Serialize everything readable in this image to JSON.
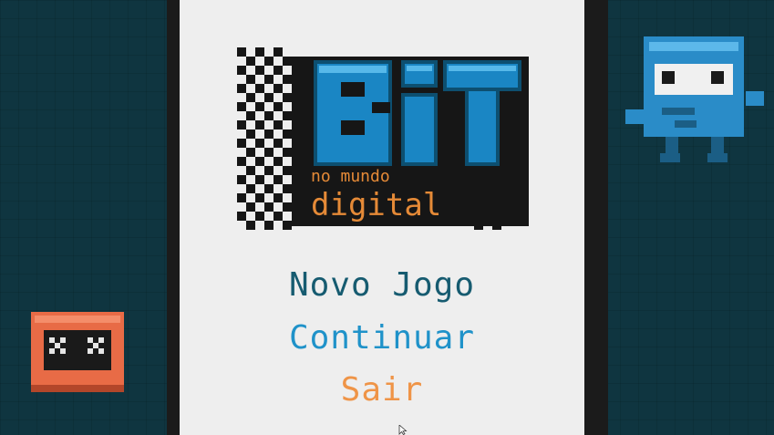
{
  "logo": {
    "title": "BIT",
    "subtitle_small": "no mundo",
    "subtitle_big": "digital"
  },
  "menu": {
    "new_game": "Novo Jogo",
    "continue": "Continuar",
    "exit": "Sair"
  },
  "characters": {
    "left": "orange-robot-icon",
    "right": "blue-robot-icon"
  },
  "colors": {
    "background": "#0f3540",
    "panel": "#eeeeee",
    "frame": "#1b1b1b",
    "logo_blue": "#1a86c4",
    "menu_new": "#165b70",
    "menu_continue": "#1f92c9",
    "menu_exit": "#ef9447"
  }
}
